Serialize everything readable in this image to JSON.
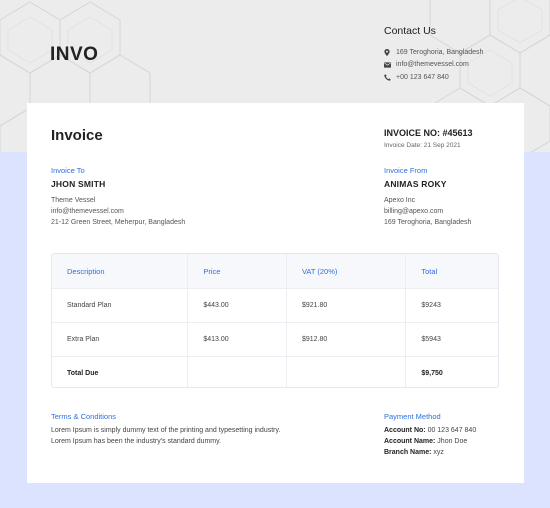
{
  "header": {
    "logo": "INVO",
    "contact": {
      "title": "Contact Us",
      "address": "169 Teroghoria, Bangladesh",
      "email": "info@themevessel.com",
      "phone": "+00 123 647 840"
    }
  },
  "invoice": {
    "title": "Invoice",
    "number": "INVOICE NO: #45613",
    "date": "Invoice Date: 21 Sep 2021"
  },
  "to": {
    "label": "Invoice To",
    "name": "JHON SMITH",
    "company": "Theme Vessel",
    "email": "info@themevessel.com",
    "address": "21-12 Green Street, Meherpur, Bangladesh"
  },
  "from": {
    "label": "Invoice From",
    "name": "ANIMAS ROKY",
    "company": "Apexo Inc",
    "email": "billing@apexo.com",
    "address": "169 Teroghoria, Bangladesh"
  },
  "table": {
    "headers": [
      "Description",
      "Price",
      "VAT (20%)",
      "Total"
    ],
    "rows": [
      {
        "description": "Standard Plan",
        "price": "$443.00",
        "vat": "$921.80",
        "total": "$9243"
      },
      {
        "description": "Extra Plan",
        "price": "$413.00",
        "vat": "$912.80",
        "total": "$5943"
      }
    ],
    "total_label": "Total Due",
    "total_value": "$9,750"
  },
  "terms": {
    "title": "Terms & Conditions",
    "text": "Lorem Ipsum is simply dummy text of the printing and typesetting industry. Lorem Ipsum has been the industry's standard dummy."
  },
  "payment": {
    "title": "Payment Method",
    "account_no_label": "Account No:",
    "account_no": "00 123 647 840",
    "account_name_label": "Account Name:",
    "account_name": "Jhon Doe",
    "branch_label": "Branch Name:",
    "branch": "xyz"
  },
  "colors": {
    "accent": "#2f6fe0",
    "band_top": "#ececec",
    "band_bottom": "#dbe3ff"
  },
  "icons": [
    "map-pin-icon",
    "envelope-icon",
    "phone-icon"
  ]
}
